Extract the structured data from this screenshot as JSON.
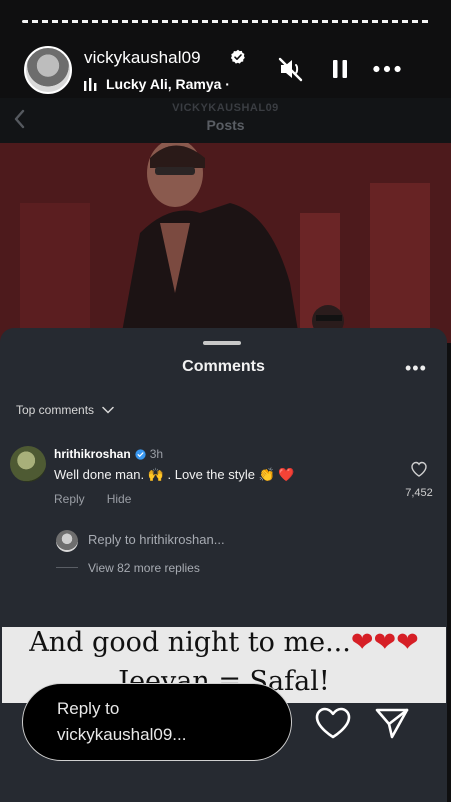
{
  "story": {
    "username": "vickykaushal09",
    "music": "Lucky Ali, Ramya ·",
    "reply_placeholder": "Reply to vickykaushal09..."
  },
  "embedded_post": {
    "account": "VICKYKAUSHAL09",
    "title": "Posts"
  },
  "comments_sheet": {
    "title": "Comments",
    "more": "•••",
    "filter": "Top comments",
    "comment": {
      "user": "hrithikroshan",
      "time": "3h",
      "text": "Well done man. 🙌 . Love the style 👏 ❤️",
      "reply_label": "Reply",
      "hide_label": "Hide",
      "likes": "7,452"
    },
    "reply_to": "Reply to hrithikroshan...",
    "view_more": "View 82 more replies"
  },
  "caption": {
    "line1": "And good night to me...",
    "hearts": "❤❤❤",
    "line2": "Jeevan = Safal!"
  },
  "colors": {
    "sheet": "#262a31",
    "verified": "#3897f0",
    "heart_red": "#d61f26"
  },
  "icons": [
    "verified-icon",
    "music-bars-icon",
    "mute-icon",
    "pause-icon",
    "more-icon",
    "back-icon",
    "chevron-down-icon",
    "heart-icon",
    "send-icon"
  ]
}
